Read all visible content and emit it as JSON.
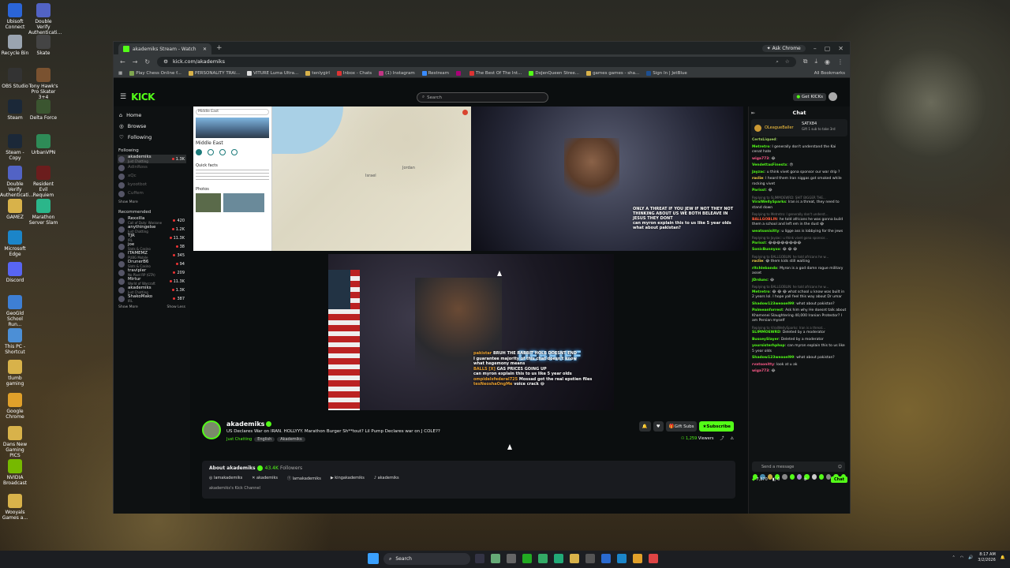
{
  "desktop": {
    "icons": [
      {
        "label": "Ubisoft Connect",
        "color": "#2b65d8"
      },
      {
        "label": "Double Verify Authenticati...",
        "color": "#5263c5"
      },
      {
        "label": "Recycle Bin",
        "color": "#9aa4b0"
      },
      {
        "label": "Skate",
        "color": "#444"
      },
      {
        "label": "OBS Studio",
        "color": "#333"
      },
      {
        "label": "Tony Hawk's Pro Skater 3+4",
        "color": "#7a5230"
      },
      {
        "label": "Steam",
        "color": "#1b2838"
      },
      {
        "label": "Delta Force",
        "color": "#3b5530"
      },
      {
        "label": "Steam - Copy",
        "color": "#1b2838"
      },
      {
        "label": "UrbanVPN",
        "color": "#2e8b57"
      },
      {
        "label": "Double Verify Authenticati...",
        "color": "#5263c5"
      },
      {
        "label": "Resident Evil Requiem",
        "color": "#6b1d1d"
      },
      {
        "label": "GAMEZ",
        "color": "#d8b24a"
      },
      {
        "label": "Marathon Server Slam",
        "color": "#2bb68a"
      },
      {
        "label": "Microsoft Edge",
        "color": "#1b85c9"
      },
      {
        "label": "Discord",
        "color": "#5865f2"
      },
      {
        "label": "GeoGld School Run...",
        "color": "#3e7fd4"
      },
      {
        "label": "This PC - Shortcut",
        "color": "#4c8fd6"
      },
      {
        "label": "tlumb gaming",
        "color": "#d8b24a"
      },
      {
        "label": "Google Chrome",
        "color": "#e0a02a"
      },
      {
        "label": "Dans New Gaming PICS",
        "color": "#d8b24a"
      },
      {
        "label": "NVIDIA Broadcast",
        "color": "#76b900"
      },
      {
        "label": "Wooyals Games a...",
        "color": "#d8b24a"
      }
    ]
  },
  "browser": {
    "tab_title": "akademiks Stream - Watch",
    "new_tab": "+",
    "ask_chrome": "Ask Chrome",
    "url": "kick.com/akademiks",
    "bookmarks": [
      {
        "label": "Play Chess Online f...",
        "color": "#7fa650"
      },
      {
        "label": "PERSONALITY TRAI...",
        "color": "#d8b24a"
      },
      {
        "label": "VITURE Luma Ultra...",
        "color": "#ddd"
      },
      {
        "label": "tenlygirl",
        "color": "#d8b24a"
      },
      {
        "label": "Inbox - Chats",
        "color": "#d33"
      },
      {
        "label": "(1) Instagram",
        "color": "#c13584"
      },
      {
        "label": "Restream",
        "color": "#3a8cff"
      },
      {
        "label": "",
        "color": "#a07"
      },
      {
        "label": "The Best Of The Int...",
        "color": "#d33"
      },
      {
        "label": "DoJenQueen Stree...",
        "color": "#53fc18"
      },
      {
        "label": "games games - sha...",
        "color": "#d8b24a"
      },
      {
        "label": "Sign In | JetBlue",
        "color": "#1d4f91"
      }
    ],
    "all_bookmarks": "All Bookmarks"
  },
  "kick": {
    "logo": "KICK",
    "search_placeholder": "Search",
    "get_kicks": "Get KICKs",
    "nav": [
      {
        "label": "Home",
        "icon": "home-icon"
      },
      {
        "label": "Browse",
        "icon": "compass-icon"
      },
      {
        "label": "Following",
        "icon": "heart-icon"
      }
    ],
    "following_header": "Following",
    "following": [
      {
        "name": "akademiks",
        "sub": "Just Chatting",
        "count": "1.3K",
        "live": true
      },
      {
        "name": "AdinRoss",
        "sub": "",
        "count": "",
        "live": false
      },
      {
        "name": "xQc",
        "sub": "",
        "count": "",
        "live": false
      },
      {
        "name": "kyootbot",
        "sub": "",
        "count": "",
        "live": false
      },
      {
        "name": "Cuffem",
        "sub": "",
        "count": "",
        "live": false
      }
    ],
    "show_more": "Show More",
    "recommended_header": "Recommended",
    "recommended": [
      {
        "name": "Rexxilla",
        "sub": "Call of Duty: Warzone",
        "count": "420"
      },
      {
        "name": "anythingelse",
        "sub": "Just Chatting",
        "count": "1.2K"
      },
      {
        "name": "TJR",
        "sub": "IRL",
        "count": "11.3K"
      },
      {
        "name": "joe",
        "sub": "Slots & Casino",
        "count": "38"
      },
      {
        "name": "ITAMEMZ",
        "sub": "PUBG Mobile",
        "count": "345"
      },
      {
        "name": "DrunerB6",
        "sub": "Slots & Casino",
        "count": "94"
      },
      {
        "name": "travipler",
        "sub": "No Pixel RP (GTA)",
        "count": "209"
      },
      {
        "name": "Mirtur",
        "sub": "World of Warcraft",
        "count": "11.3K"
      },
      {
        "name": "akademiks",
        "sub": "Just Chatting",
        "count": "1.3K"
      },
      {
        "name": "ShakoMako",
        "sub": "IRL",
        "count": "387"
      }
    ],
    "show_less": "Show Less",
    "video": {
      "map_search": "Middle East",
      "map_heading": "Middle East",
      "map_quick_facts": "Quick facts",
      "map_photos": "Photos",
      "map_label_israel": "Israel",
      "map_label_jordan": "Jordan",
      "overlay_topA": [
        "ONLY A THREAT IF YOU JEW IF NOT THEY NOT",
        "THINKING ABOUT US WE BOTH BELEAVE IN",
        "JESUS THEY DONT",
        "can myron explain this to us like 5 year olds",
        "what about pakistan?"
      ],
      "neon_text": "DEBRIEF",
      "overlay_chat": [
        {
          "user": "pakistar",
          "text": "BRUH THE RABBIT HOLE DOESNT END"
        },
        {
          "user": "",
          "text": "I guarantee majority of this chat doesn't know"
        },
        {
          "user": "",
          "text": "what hegemony means"
        },
        {
          "user": "BALLS [X]",
          "text": "GAS PRICES GOING UP"
        },
        {
          "user": "",
          "text": "can myron explain this to us like 5 year olds"
        },
        {
          "user": "ompidelsfederal725",
          "text": "Mossad got the real epstien files"
        },
        {
          "user": "tesNeoshaOngMe",
          "text": "voice crack 😂"
        }
      ]
    },
    "stream": {
      "channel": "akademiks",
      "title": "US Declares War on IRAN. HOLLYYY. Marathon Burger Sh**tout? Lil Pump Declares war on J COLE??",
      "category": "Just Chatting",
      "tags": [
        "English",
        "Akademiks"
      ],
      "gift_subs": "Gift Subs",
      "subscribe": "Subscribe",
      "viewers": "1,259",
      "viewers_label": "Viewers"
    },
    "about": {
      "heading": "About akademiks",
      "followers": "43.4K",
      "followers_label": "Followers",
      "socials": [
        {
          "icon": "instagram-icon",
          "label": "lamakademiks"
        },
        {
          "icon": "x-icon",
          "label": "akademiks"
        },
        {
          "icon": "facebook-icon",
          "label": "lamakademiks"
        },
        {
          "icon": "youtube-icon",
          "label": "kingakademiks"
        },
        {
          "icon": "tiktok-icon",
          "label": "akademiks"
        }
      ],
      "description": "akademiks's Kick Channel"
    },
    "chat": {
      "title": "Chat",
      "pinned_user": "OLeagueBaller",
      "pinned_badge": "1",
      "pinned_right": "SATX84",
      "pinned_note": "Gift 1 sub to take 3rd",
      "messages": [
        {
          "user": "CertsLiqued",
          "color": "#a0d060",
          "text": "",
          "reply": ""
        },
        {
          "user": "Metretro",
          "color": "#53fc18",
          "text": "I generally don't understand the Kai cenat hate",
          "reply": ""
        },
        {
          "user": "wiga773",
          "color": "#ff5a8a",
          "text": "😂",
          "reply": ""
        },
        {
          "user": "VendettasFinestx",
          "color": "#53fc18",
          "text": "😠",
          "reply": ""
        },
        {
          "user": "Jayzac",
          "color": "#53fc18",
          "text": "u think vivet gona sponsor our war drip ?",
          "reply": ""
        },
        {
          "user": "roclie",
          "color": "#ffd84a",
          "text": "I heard them Iran niggas got smoked while rocking vivet",
          "reply": ""
        },
        {
          "user": "Parisst",
          "color": "#53fc18",
          "text": "😂",
          "reply": ""
        },
        {
          "user": "ViralWellySparks",
          "color": "#53fc18",
          "text": "Iran is a threat, they need to stand down",
          "reply": "Replying to SLIMMOEWRD: SHIT BIGGER THE..."
        },
        {
          "user": "BALLGOBLIN",
          "color": "#ff5a3a",
          "text": "he told africans he was gonna build them a school and left em in the dust 😂",
          "reply": "Replying to Metretro: I generally don't underst..."
        },
        {
          "user": "weatsonisitty",
          "color": "#53fc18",
          "text": "u ligge ass is lobbying for the jews",
          "reply": ""
        },
        {
          "user": "Parisst",
          "color": "#53fc18",
          "text": "😂😂😂😂😂😂😂😂",
          "reply": "Replying to Jayzac: u think vivet gona sponsor..."
        },
        {
          "user": "SonicBunnyxo",
          "color": "#53fc18",
          "text": "😂 😂 😂",
          "reply": ""
        },
        {
          "user": "roclie",
          "color": "#ffd84a",
          "text": "😂 them kids still waiting",
          "reply": "Replying to BALLGOBLIN: he told africans he w..."
        },
        {
          "user": "rltchlebanda",
          "color": "#53fc18",
          "text": "Myron is a god damn rogue military asset",
          "reply": ""
        },
        {
          "user": "JDrdunc",
          "color": "#53fc18",
          "text": "😂",
          "reply": ""
        },
        {
          "user": "Metretro",
          "color": "#53fc18",
          "text": "😂 😂 😂 what school u know was built in 2 years lol. I hope yall feel this way about Dr umar",
          "reply": "Replying to BALLGOBLIN: he told africans he w..."
        },
        {
          "user": "Shadow123weaseI99",
          "color": "#53fc18",
          "text": "what about pakistan?",
          "reply": ""
        },
        {
          "user": "Palmeanforrest",
          "color": "#53fc18",
          "text": "Ask him why He doesnt talk about Khamenei Slaughtering 40,000 Iranian Protestor? I am Persian myself",
          "reply": ""
        },
        {
          "user": "SLIMMOEWRD",
          "color": "#53fc18",
          "text": "Deleted by a moderator",
          "reply": "Replying to ViralWellySparks: Iran is a threat..."
        },
        {
          "user": "BusseySlayer",
          "color": "#53fc18",
          "text": "Deleted by a moderator",
          "reply": ""
        },
        {
          "user": "yoursisterhphop",
          "color": "#53fc18",
          "text": "can myron explain this to us like 5 year olds",
          "reply": ""
        },
        {
          "user": "Shadow123weaseI99",
          "color": "#53fc18",
          "text": "what about pakistan?",
          "reply": ""
        },
        {
          "user": "rvatsonitty",
          "color": "#ff5a8a",
          "text": "look at u ak",
          "reply": ""
        },
        {
          "user": "wiga773",
          "color": "#ff5a8a",
          "text": "😂",
          "reply": ""
        }
      ],
      "send_placeholder": "Send a message",
      "points": "7,870",
      "kicks": "0",
      "chat_button": "Chat"
    }
  },
  "taskbar": {
    "search": "Search",
    "time": "8:17 AM",
    "date": "3/2/2026"
  }
}
